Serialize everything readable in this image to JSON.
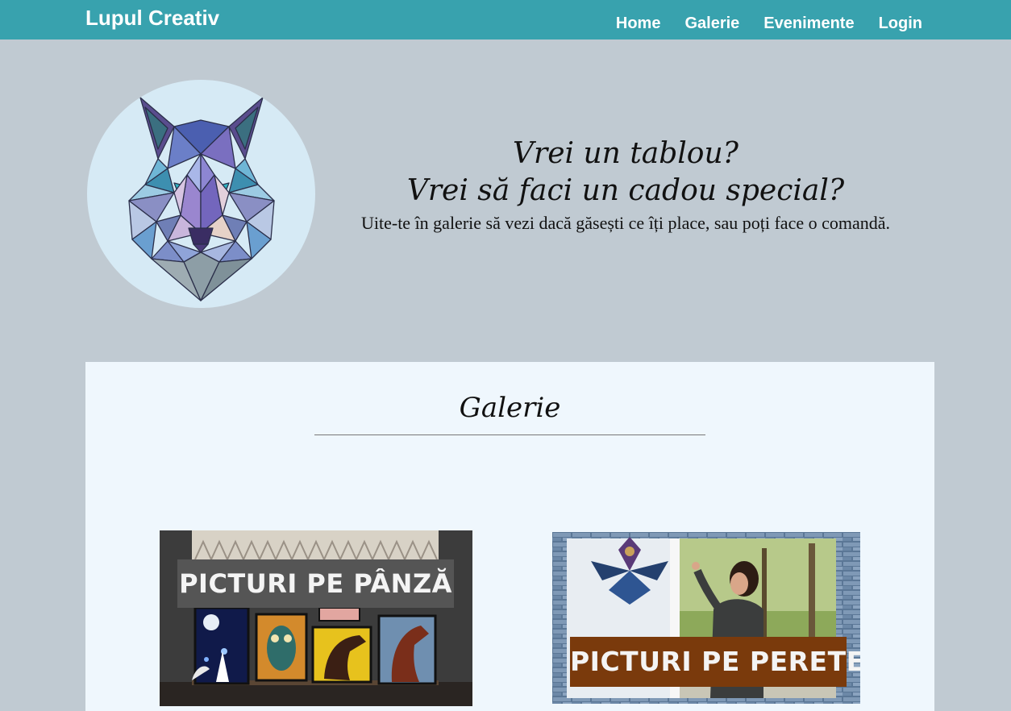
{
  "navbar": {
    "brand": "Lupul Creativ",
    "links": [
      "Home",
      "Galerie",
      "Evenimente",
      "Login"
    ],
    "bg_color": "#38a2ae"
  },
  "hero": {
    "line1": "Vrei un tablou?",
    "line2": "Vrei să faci un cadou special?",
    "subtitle": "Uite-te în galerie să vezi dacă găsești ce îți place, sau poți face o comandă."
  },
  "gallery": {
    "title": "Galerie",
    "cards": [
      {
        "label": "PICTURI PE PÂNZĂ"
      },
      {
        "label": "PICTURI PE PERETE"
      }
    ]
  },
  "colors": {
    "page_bg": "#c0cad2",
    "panel_bg": "#eff7fd",
    "logo_circle": "#d6eaf5",
    "panza_label_bg": "#555555",
    "perete_label_bg": "#7a3a0c"
  }
}
